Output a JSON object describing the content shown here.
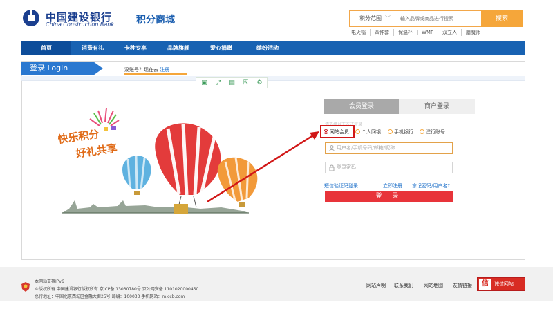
{
  "header": {
    "brand_cn": "中国建设银行",
    "brand_en": "China Construction Bank",
    "mall_title": "积分商城",
    "search": {
      "scope_label": "积分范围",
      "placeholder": "输入品牌或商品进行搜索",
      "button_label": "搜索"
    },
    "hot_words": [
      "电火锅",
      "四件套",
      "保温杯",
      "WMF",
      "双立人",
      "膳魔师"
    ]
  },
  "nav": {
    "items": [
      {
        "label": "首页",
        "active": true
      },
      {
        "label": "消费有礼",
        "active": false
      },
      {
        "label": "卡种专享",
        "active": false
      },
      {
        "label": "品牌旗舰",
        "active": false
      },
      {
        "label": "爱心捐赠",
        "active": false
      },
      {
        "label": "缤纷活动",
        "active": false
      }
    ]
  },
  "login_page": {
    "banner_label": "登录 Login",
    "register_tip": "没账号？现在去",
    "register_link": "注册",
    "toolbar_icons": [
      "image-icon",
      "expand-icon",
      "save-icon",
      "share-icon",
      "settings-icon"
    ],
    "illustration": {
      "slogan_line1": "快乐积分",
      "slogan_line2": "好礼共享"
    }
  },
  "login_form": {
    "tabs": [
      "会员登录",
      "商户登录"
    ],
    "faded_hint": "请选择以下方式登录",
    "options": [
      {
        "label": "网站会员",
        "selected": true
      },
      {
        "label": "个人网银",
        "selected": false
      },
      {
        "label": "手机银行",
        "selected": false
      },
      {
        "label": "建行账号",
        "selected": false
      }
    ],
    "username_placeholder": "用户名/手机号码/邮箱/昵称",
    "password_placeholder": "登录密码",
    "sms_login": "短信验证码登录",
    "quick_register": "立即注册",
    "forgot": "忘记密码/用户名?",
    "login_button": "登 录"
  },
  "footer": {
    "line1": "本网站支持IPv6",
    "line2": "©版权所有 中国建设银行版权所有 京ICP备 13030780号 京公网安备 1101020000450",
    "line3": "总行地址：中国北京西城区金融大街25号 邮编：100033 手机网站：m.ccb.com",
    "links": [
      "网站声明",
      "联系我们",
      "网站地图",
      "友情链接"
    ],
    "trust_mark": "信",
    "trust_text": "诚信网站"
  },
  "colors": {
    "nav_blue": "#1862b2",
    "accent_orange": "#f5a63a",
    "login_red": "#e8343a",
    "annotation_red": "#d11717"
  }
}
